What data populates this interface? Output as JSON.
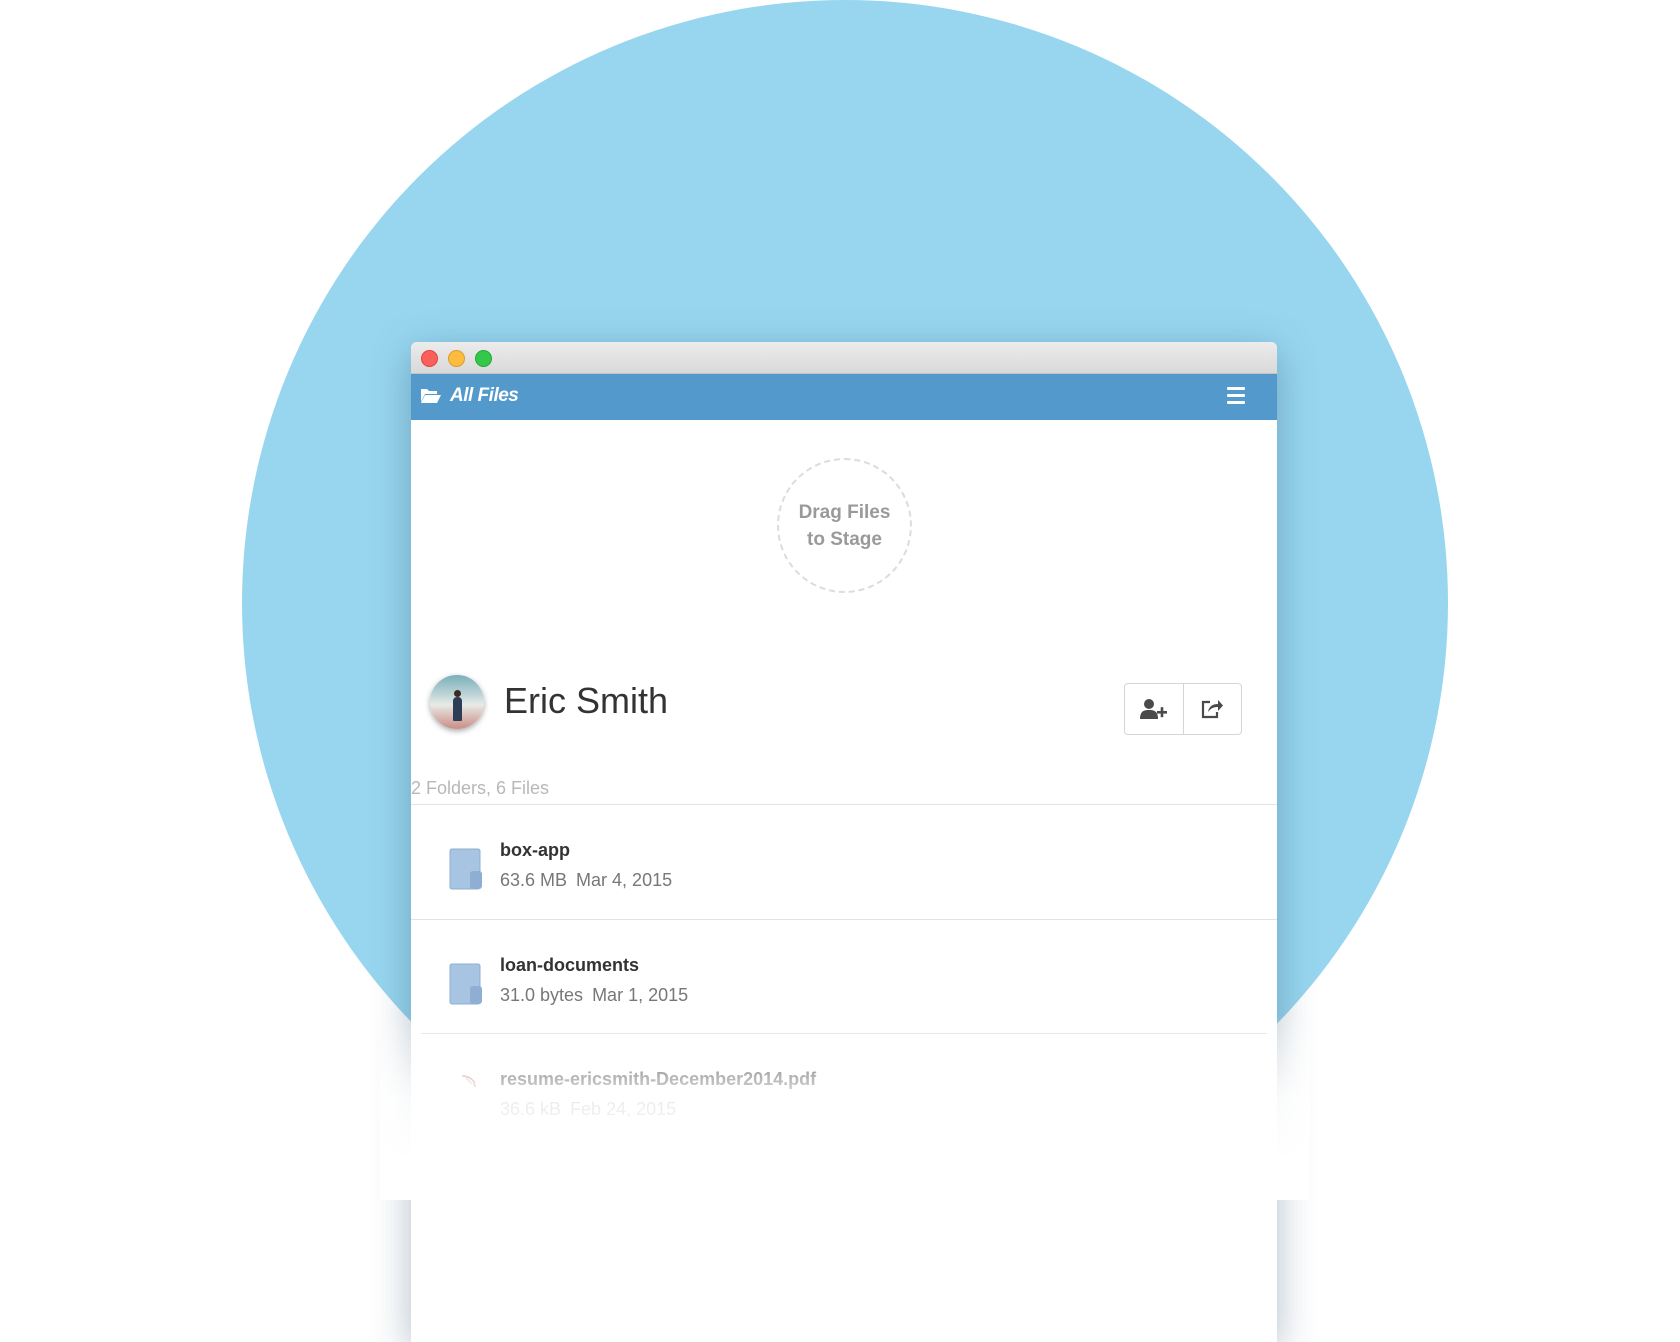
{
  "appbar": {
    "title": "All Files"
  },
  "dropzone": {
    "line1": "Drag Files",
    "line2": "to Stage"
  },
  "profile": {
    "name": "Eric Smith"
  },
  "summary": "2 Folders, 6 Files",
  "items": [
    {
      "name": "box-app",
      "size": "63.6 MB",
      "date": "Mar 4, 2015",
      "icon": "folder-icon"
    },
    {
      "name": "loan-documents",
      "size": "31.0 bytes",
      "date": "Mar 1, 2015",
      "icon": "folder-icon"
    },
    {
      "name": "resume-ericsmith-December2014.pdf",
      "size": "36.6 kB",
      "date": "Feb 24, 2015",
      "icon": "pdf-icon"
    }
  ],
  "colors": {
    "background_circle": "#98d6ef",
    "appbar": "#5399cc",
    "folder": "#a7c4e2"
  }
}
